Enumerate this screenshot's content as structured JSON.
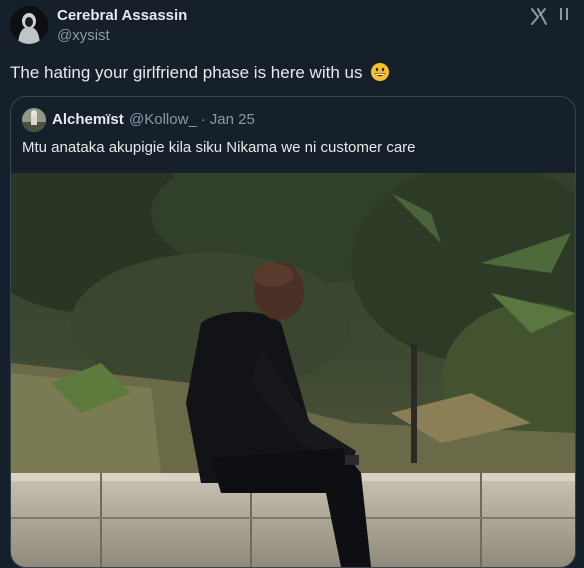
{
  "author": {
    "name": "Cerebral Assassin",
    "handle": "@xysist"
  },
  "tweet": {
    "text": "The hating your girlfriend phase is here with us",
    "emoji": "grinning-face-emoji"
  },
  "icons": {
    "brand": "x-logo-icon",
    "more": "more-icon"
  },
  "quote": {
    "name": "Alchemïst",
    "handle": "@Kollow_",
    "separator": "·",
    "date": "Jan 25",
    "text": "Mtu anataka akupigie kila siku Nikama we ni customer care",
    "photo": "man-in-black-jacket-sitting-on-stone-wall-photo"
  },
  "colors": {
    "background": "#15202b",
    "text": "#e7e9ea",
    "muted": "#8b98a5",
    "border": "#38444d"
  }
}
